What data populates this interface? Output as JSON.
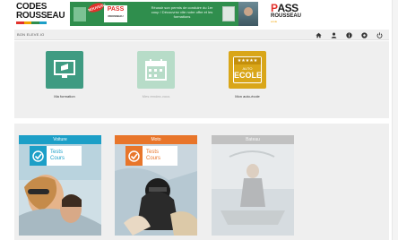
{
  "header": {
    "logo_left": {
      "line1": "CODES",
      "line2": "ROUSSEAU"
    },
    "banner": {
      "badge": "NOUVEAU",
      "pass_brand": "PASS",
      "pass_sub": "ROUSSEAU",
      "text": "Réussir son permis de conduire du 1er coup ! Découvrez vite notre offre et les formations"
    },
    "logo_right": {
      "line1_a": "P",
      "line1_b": "ASS",
      "line2": "ROUSSEAU",
      "line3": "ecole"
    }
  },
  "toolbar": {
    "label": "BON ELEVE.IO",
    "icons": [
      "home-icon",
      "user-icon",
      "info-icon",
      "settings-icon",
      "power-icon"
    ]
  },
  "tiles": [
    {
      "name": "ma-formation",
      "label": "Ma formation",
      "color": "#3f9b82",
      "faded": false
    },
    {
      "name": "mes-rendez-vous",
      "label": "Mes rendez-vous",
      "color": "#b7dcc8",
      "faded": true
    },
    {
      "name": "mon-auto-ecole",
      "label": "Mon auto-école",
      "color": "#d9a619",
      "stars": "★★★★★",
      "sign_top": "AUTO",
      "sign_bottom": "ECOLE",
      "faded": false
    }
  ],
  "cards": [
    {
      "name": "voiture",
      "title": "Voiture",
      "color": "#1c9fc7",
      "tests": "Tests",
      "cours": "Cours",
      "faded": false
    },
    {
      "name": "moto",
      "title": "Moto",
      "color": "#e8752a",
      "tests": "Tests",
      "cours": "Cours",
      "faded": false
    },
    {
      "name": "bateau",
      "title": "Bateau",
      "color": "#8b8b8b",
      "faded": true
    }
  ]
}
